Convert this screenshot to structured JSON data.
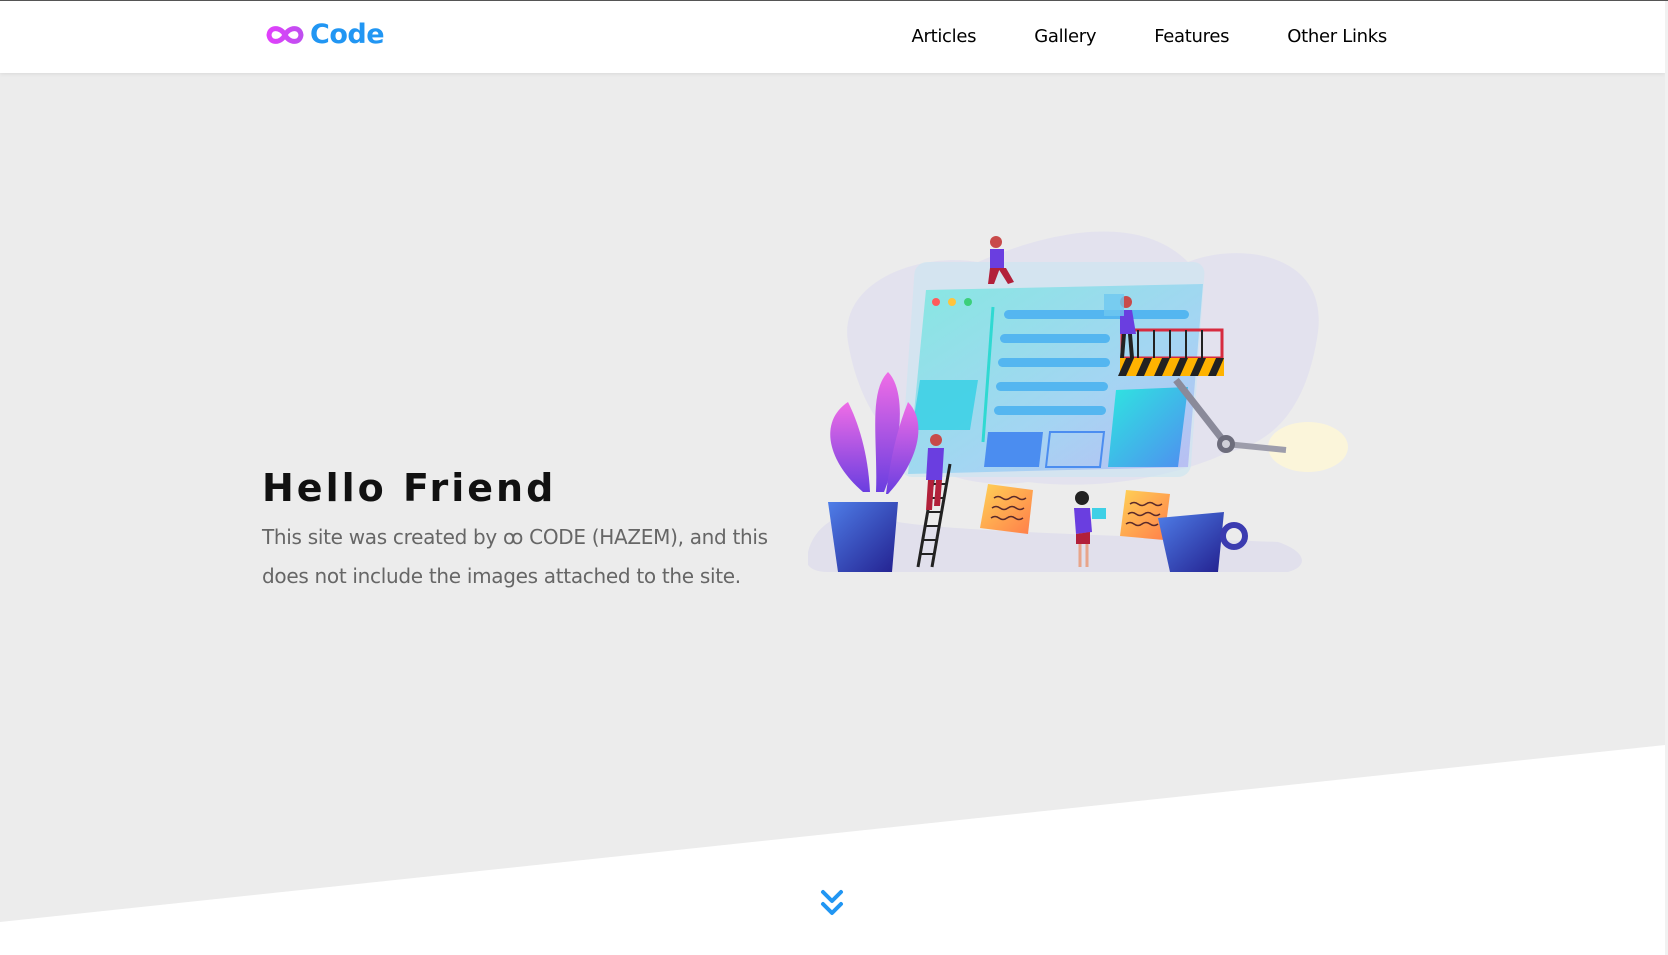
{
  "header": {
    "logo_text": "Code",
    "logo_icon": "infinity-icon",
    "nav": [
      {
        "label": "Articles"
      },
      {
        "label": "Gallery"
      },
      {
        "label": "Features"
      },
      {
        "label": "Other Links"
      }
    ]
  },
  "hero": {
    "title": "Hello Friend",
    "description": "This site was created by ꝏ CODE (HAZEM), and this does not include the images attached to the site.",
    "illustration": "website-builders-illustration"
  },
  "scroll_down": {
    "icon": "double-chevron-down-icon"
  },
  "colors": {
    "brand_blue": "#2196f3",
    "brand_pink": "#e040fb",
    "hero_background": "#ececec"
  }
}
